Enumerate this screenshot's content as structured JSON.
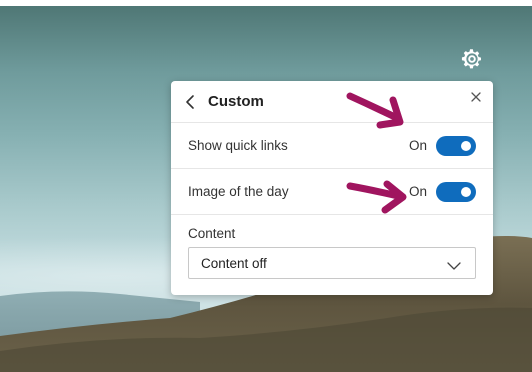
{
  "panel": {
    "title": "Custom",
    "settings": [
      {
        "label": "Show quick links",
        "state": "On"
      },
      {
        "label": "Image of the day",
        "state": "On"
      }
    ],
    "content": {
      "label": "Content",
      "selected": "Content off"
    }
  },
  "icons": {
    "settings": "gear-icon",
    "back": "chevron-left-icon",
    "close": "close-icon",
    "dropdown": "chevron-down-icon"
  },
  "colors": {
    "toggle_on": "#0f6cbd",
    "annotation_arrow": "#a0155f"
  }
}
